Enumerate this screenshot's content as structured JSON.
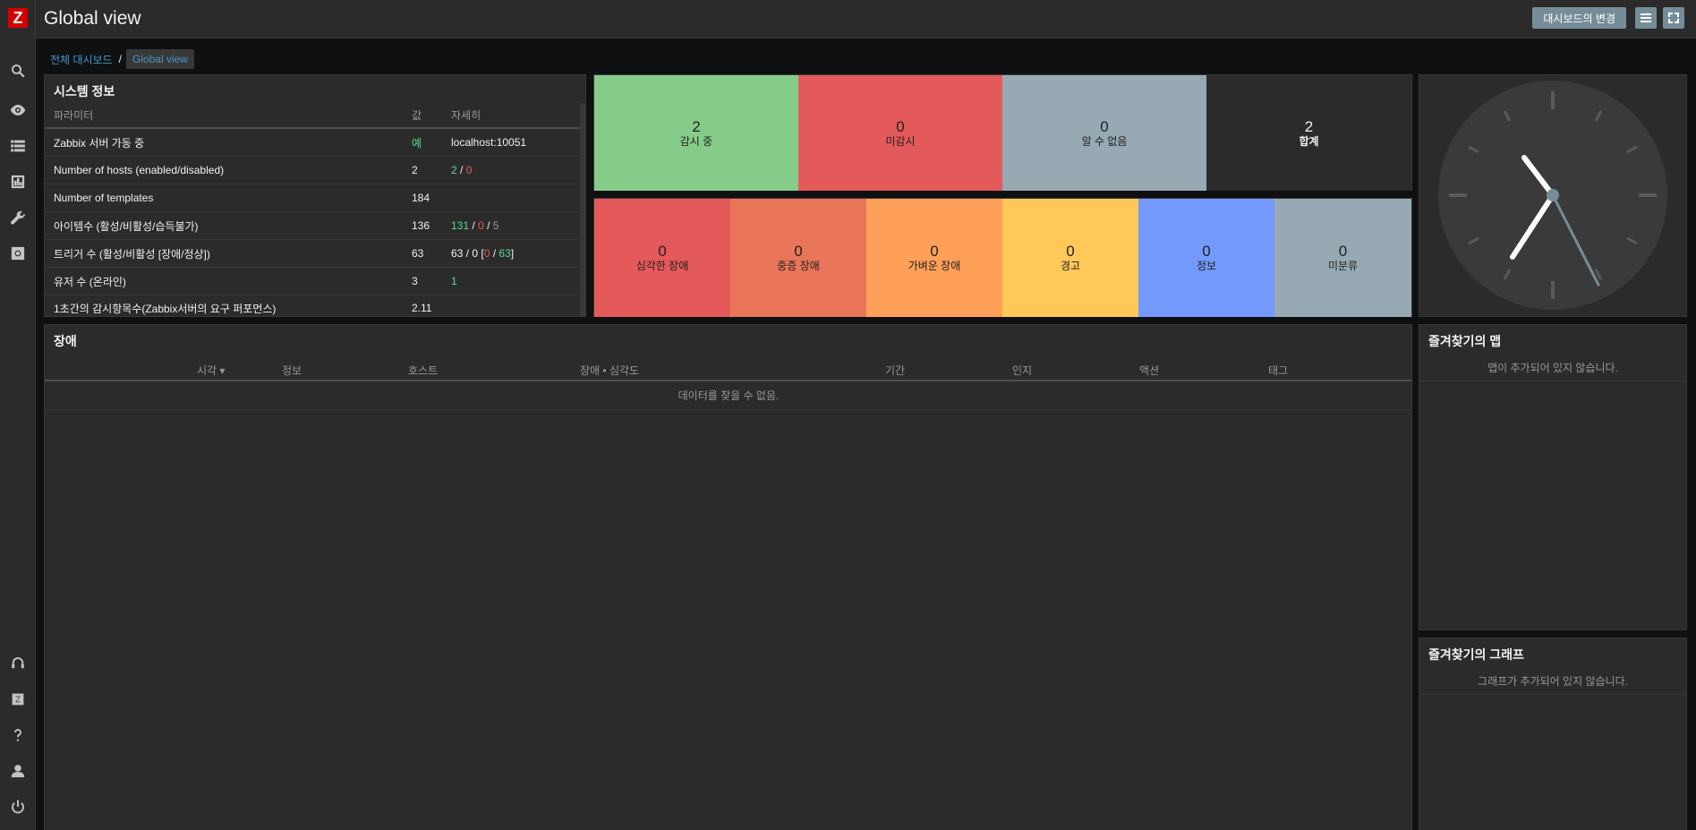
{
  "header": {
    "title": "Global view",
    "edit_button": "대시보드의 변경"
  },
  "breadcrumb": {
    "parent": "전체 대시보드",
    "separator": "/",
    "current": "Global view"
  },
  "system_info": {
    "title": "시스템 정보",
    "columns": [
      "파라미터",
      "값",
      "자세히"
    ],
    "rows": [
      {
        "param": "Zabbix 서버 가동 중",
        "value": "예",
        "details": "localhost:10051"
      },
      {
        "param": "Number of hosts (enabled/disabled)",
        "value": "2",
        "d1": "2",
        "s1": " / ",
        "d2": "0"
      },
      {
        "param": "Number of templates",
        "value": "184",
        "details": ""
      },
      {
        "param": "아이템수 (활성/비활성/습득불가)",
        "value": "136",
        "d1": "131",
        "s1": " / ",
        "d2": "0",
        "s2": " / ",
        "d3": "5"
      },
      {
        "param": "트리거 수 (활성/비활성 [장애/정상])",
        "value": "63",
        "p1": "63 / 0 [",
        "d2": "0",
        "s2": " / ",
        "d3": "63",
        "p2": "]"
      },
      {
        "param": "유저 수 (온라인)",
        "value": "3",
        "d1": "1"
      },
      {
        "param": "1초간의 감시항목수(Zabbix서버의 요구 퍼포먼스)",
        "value": "2.11",
        "details": ""
      }
    ]
  },
  "host_availability": {
    "tiles": [
      {
        "count": "2",
        "label": "감시 중",
        "color": "#86cc89"
      },
      {
        "count": "0",
        "label": "미감시",
        "color": "#e45959"
      },
      {
        "count": "0",
        "label": "알 수 없음",
        "color": "#97aab3"
      },
      {
        "count": "2",
        "label": "합계",
        "color": "#2b2b2b"
      }
    ]
  },
  "problems_by_severity": {
    "tiles": [
      {
        "count": "0",
        "label": "심각한 장애",
        "color": "#e45959"
      },
      {
        "count": "0",
        "label": "중증 장애",
        "color": "#e97659"
      },
      {
        "count": "0",
        "label": "가벼운 장애",
        "color": "#ffa059"
      },
      {
        "count": "0",
        "label": "경고",
        "color": "#ffc859"
      },
      {
        "count": "0",
        "label": "정보",
        "color": "#7499ff"
      },
      {
        "count": "0",
        "label": "미분류",
        "color": "#97aab3"
      }
    ]
  },
  "problems": {
    "title": "장애",
    "columns": [
      "시각 ▾",
      "정보",
      "호스트",
      "장애 • 심각도",
      "기간",
      "인지",
      "액션",
      "태그"
    ],
    "empty_text": "데이터를 찾을 수 없음."
  },
  "fav_maps": {
    "title": "즐겨찾기의 맵",
    "empty_text": "맵이 추가되어 있지 않습니다."
  },
  "fav_graphs": {
    "title": "즐겨찾기의 그래프",
    "empty_text": "그래프가 추가되어 있지 않습니다."
  },
  "colors": {
    "accent_link": "#4796c4",
    "green": "#59db8f",
    "red": "#e45959"
  }
}
